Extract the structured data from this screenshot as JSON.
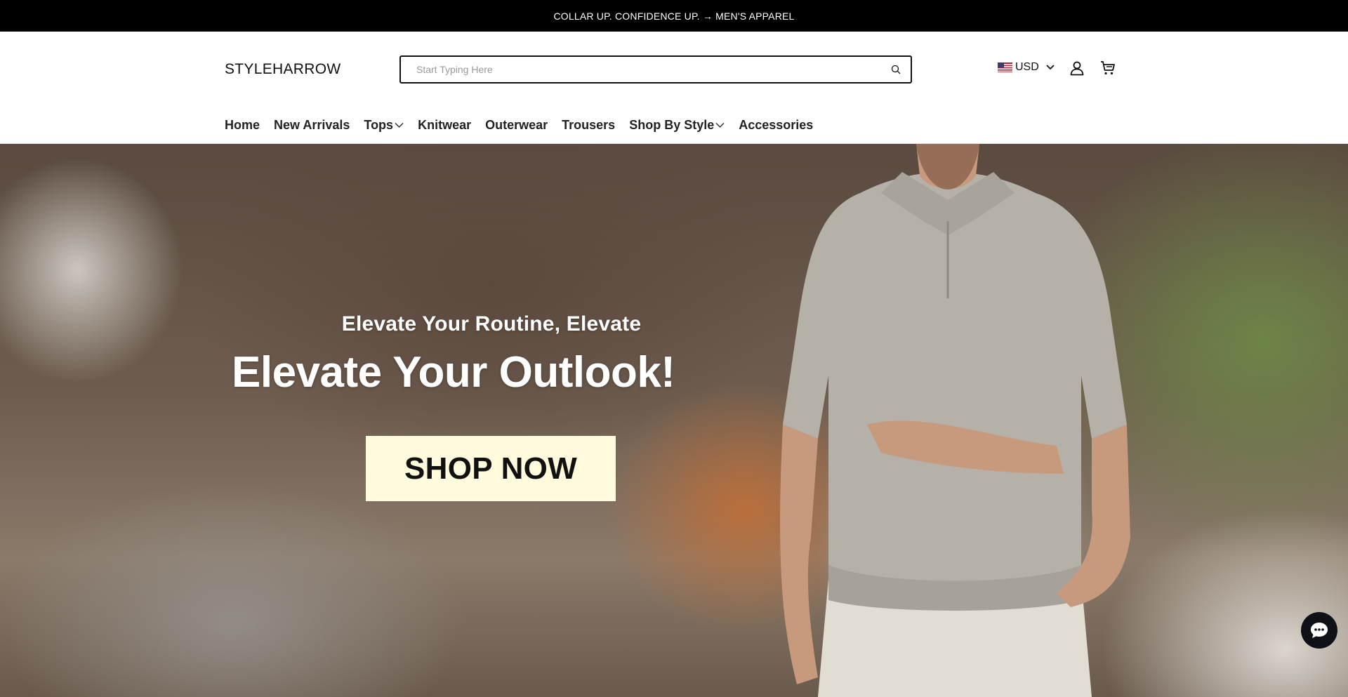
{
  "announcement": {
    "text": "COLLAR UP. CONFIDENCE UP. → MEN'S APPAREL"
  },
  "header": {
    "logo": "STYLEHARROW",
    "search": {
      "placeholder": "Start Typing Here",
      "value": ""
    },
    "currency": {
      "label": "USD"
    }
  },
  "nav": {
    "items": [
      {
        "label": "Home"
      },
      {
        "label": "New Arrivals"
      },
      {
        "label": "Tops"
      },
      {
        "label": "Knitwear"
      },
      {
        "label": "Outerwear"
      },
      {
        "label": "Trousers"
      },
      {
        "label": "Shop By Style"
      },
      {
        "label": "Accessories"
      }
    ]
  },
  "hero": {
    "subtitle": "Elevate Your Routine, Elevate",
    "title": "Elevate Your Outlook!",
    "cta_label": "SHOP NOW"
  },
  "colors": {
    "announcement_bg": "#000000",
    "cta_bg": "#fffbdc",
    "chat_bg": "#0e1116"
  },
  "icons": [
    "search-icon",
    "us-flag-icon",
    "chevron-down-icon",
    "user-icon",
    "cart-icon",
    "chat-icon"
  ]
}
